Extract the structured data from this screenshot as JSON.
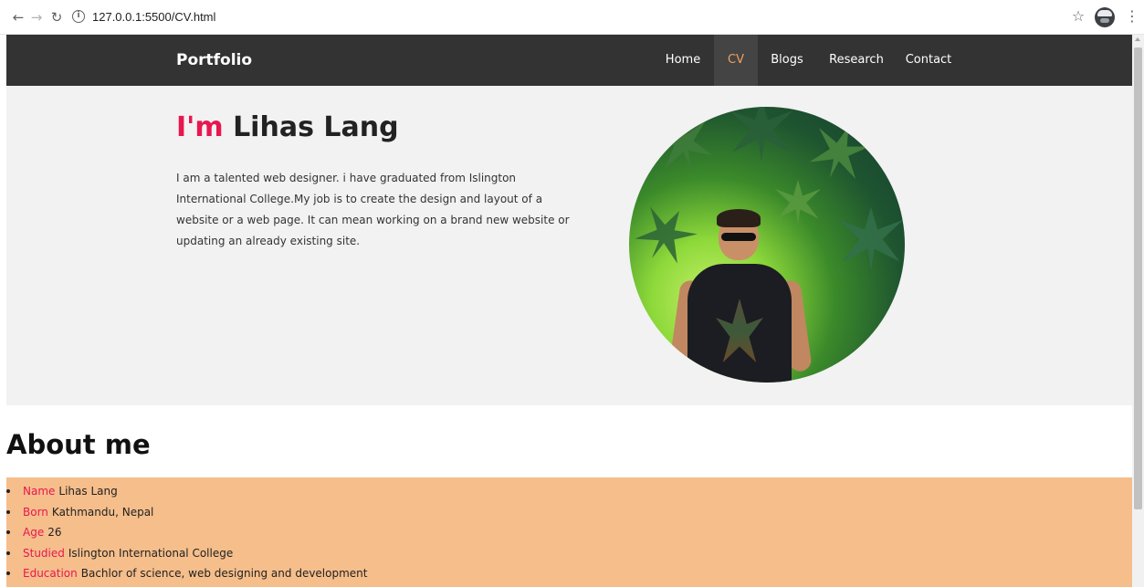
{
  "browser": {
    "url": "127.0.0.1:5500/CV.html",
    "icons": {
      "back": "arrow-left",
      "forward": "arrow-right",
      "reload": "reload",
      "site_info": "info",
      "bookmark": "star",
      "profile": "avatar",
      "menu": "kebab"
    }
  },
  "navbar": {
    "brand": "Portfolio",
    "links": [
      {
        "label": "Home",
        "active": false
      },
      {
        "label": "CV",
        "active": true
      },
      {
        "label": "Blogs",
        "active": false
      },
      {
        "label": "Research",
        "active": false
      },
      {
        "label": "Contact",
        "active": false
      }
    ]
  },
  "hero": {
    "title_prefix": "I'm",
    "title_name": "Lihas Lang",
    "description": "I am a talented web designer. i have graduated from Islington International College.My job is to create the design and layout of a website or a web page. It can mean working on a brand new website or updating an already existing site."
  },
  "about": {
    "heading": "About me",
    "items": [
      {
        "key": "Name",
        "value": "Lihas Lang"
      },
      {
        "key": "Born",
        "value": "Kathmandu, Nepal"
      },
      {
        "key": "Age",
        "value": "26"
      },
      {
        "key": "Studied",
        "value": "Islington International College"
      },
      {
        "key": "Education",
        "value": "Bachlor of science, web designing and development"
      }
    ]
  },
  "colors": {
    "accent": "#e8174f",
    "navbar_bg": "#333333",
    "active_link": "#f0a060",
    "hero_bg": "#f2f2f2",
    "about_bg": "#f5be8b"
  }
}
